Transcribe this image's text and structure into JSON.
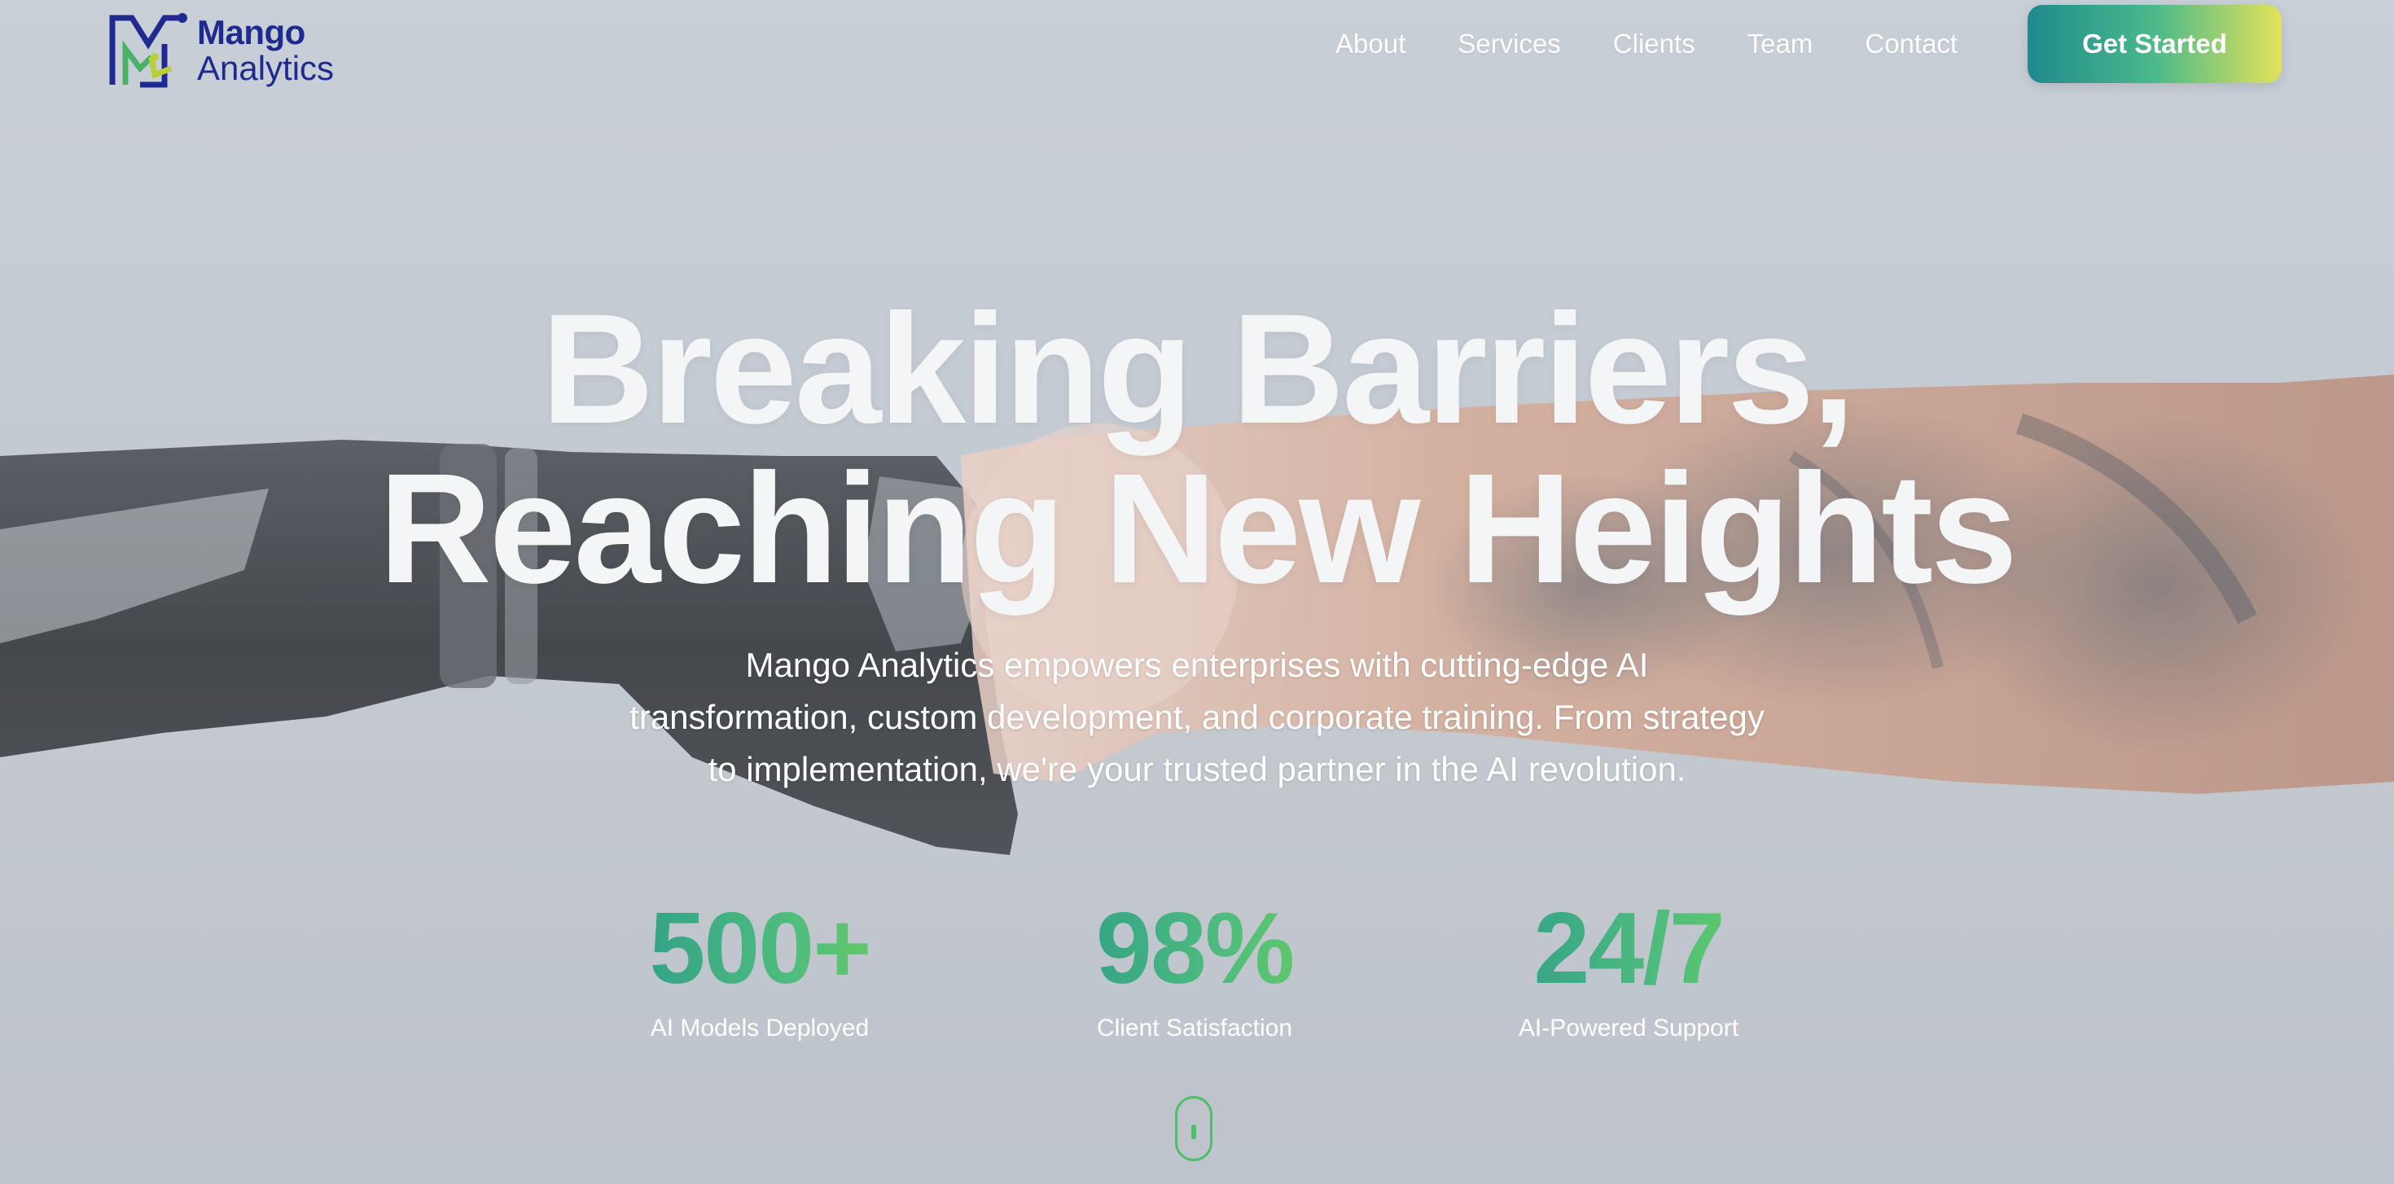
{
  "brand": {
    "name_line1": "Mango",
    "name_line2": "Analytics",
    "color": "#1f2a8f",
    "logo_icon": "mango-m-logo-icon"
  },
  "nav": {
    "links": [
      "About",
      "Services",
      "Clients",
      "Team",
      "Contact"
    ],
    "cta_label": "Get Started",
    "cta_gradient": [
      "#1f8a8e",
      "#4bb98a",
      "#e2e35a"
    ]
  },
  "hero": {
    "title_line1": "Breaking Barriers,",
    "title_line2": "Reaching New Heights",
    "subtitle_line1": "Mango Analytics empowers enterprises with cutting-edge AI",
    "subtitle_line2": "transformation, custom development, and corporate training. From strategy",
    "subtitle_line3": "to implementation, we're your trusted partner in the AI revolution.",
    "background_image": "robot-hand-fist-bump-human-tattooed-arm"
  },
  "stats": [
    {
      "value": "500+",
      "label": "AI Models Deployed"
    },
    {
      "value": "98%",
      "label": "Client Satisfaction"
    },
    {
      "value": "24/7",
      "label": "AI-Powered Support"
    }
  ],
  "scroll_indicator": {
    "icon": "mouse-scroll-icon",
    "color": "#4fbd6a"
  }
}
